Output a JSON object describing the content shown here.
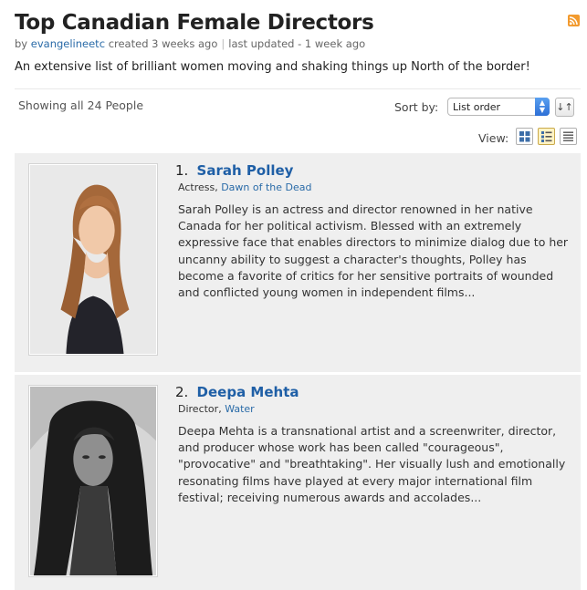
{
  "page": {
    "title": "Top Canadian Female Directors",
    "byline": {
      "prefix": "by",
      "author": "evangelineetc",
      "created": "created 3 weeks ago",
      "updated": "last updated - 1 week ago"
    },
    "description": "An extensive list of brilliant women moving and shaking things up North of the border!"
  },
  "controls": {
    "showing": "Showing all 24 People",
    "sort_label": "Sort by:",
    "sort_value": "List order",
    "sort_direction_icon": "sort-direction-icon",
    "view_label": "View:",
    "view_modes": [
      "grid",
      "detail",
      "compact"
    ],
    "active_view": "detail"
  },
  "people": [
    {
      "number": "1.",
      "name": "Sarah Polley",
      "role": "Actress,",
      "known_for": "Dawn of the Dead",
      "bio": "Sarah Polley is an actress and director renowned in her native Canada for her political activism. Blessed with an extremely expressive face that enables directors to minimize dialog due to her uncanny ability to suggest a character's thoughts, Polley has become a favorite of critics for her sensitive portraits of wounded and conflicted young women in independent films..."
    },
    {
      "number": "2.",
      "name": "Deepa Mehta",
      "role": "Director,",
      "known_for": "Water",
      "bio": "Deepa Mehta is a transnational artist and a screenwriter, director, and producer whose work has been called \"courageous\", \"provocative\" and \"breathtaking\". Her visually lush and emotionally resonating films have played at every major international film festival; receiving numerous awards and accolades..."
    }
  ],
  "colors": {
    "link": "#2a6ba8",
    "name": "#1f5fa6",
    "rss": "#f29a2e",
    "item_bg": "#efefef"
  }
}
